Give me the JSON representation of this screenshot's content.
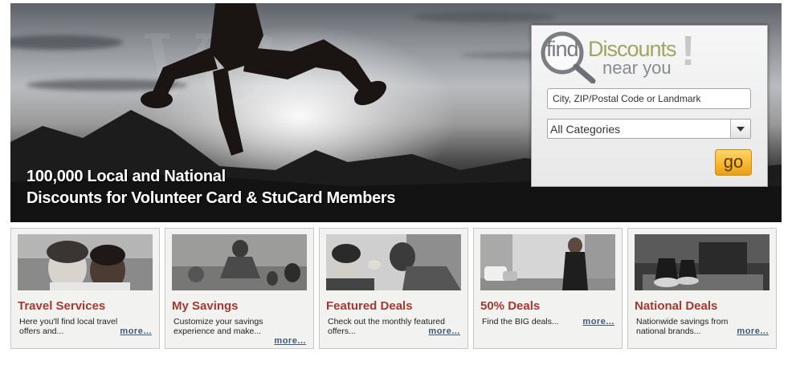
{
  "hero": {
    "headline_line1": "100,000 Local and National",
    "headline_line2": "Discounts for Volunteer Card & StuCard Members"
  },
  "search_widget": {
    "logo": {
      "find": "find",
      "discounts": "Discounts",
      "near_you": "near you",
      "exclaim": "!"
    },
    "location_placeholder": "City, ZIP/Postal Code or Landmark",
    "category_selected": "All Categories",
    "go_label": "go"
  },
  "cards": [
    {
      "title": "Travel Services",
      "desc": "Here you'll find local travel offers and...",
      "more": "more..."
    },
    {
      "title": "My Savings",
      "desc": "Customize your savings experience and make...",
      "more": "more..."
    },
    {
      "title": "Featured Deals",
      "desc": "Check out the monthly featured offers...",
      "more": "more..."
    },
    {
      "title": "50% Deals",
      "desc": "Find the BIG deals...",
      "more": "more..."
    },
    {
      "title": "National Deals",
      "desc": "Nationwide savings from national brands...",
      "more": "more..."
    }
  ],
  "colors": {
    "card_title": "#a33a2f",
    "more_link": "#3e5a78",
    "go_button": "#f5b52c",
    "logo_discounts": "#a1a561"
  }
}
